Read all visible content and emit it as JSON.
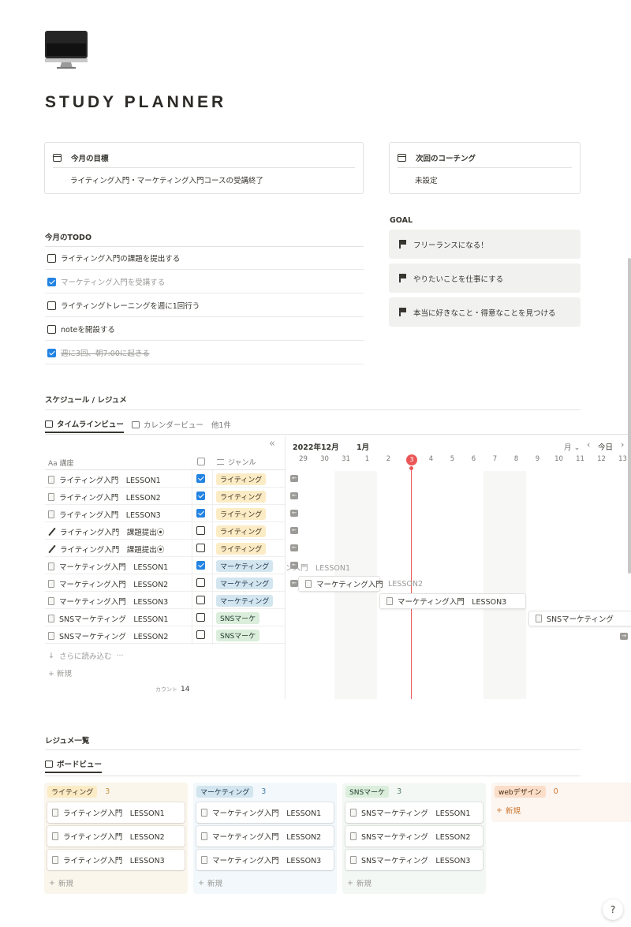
{
  "page": {
    "title": "STUDY PLANNER",
    "icon": "desktop-computer-icon"
  },
  "callouts": {
    "monthly_goal": {
      "title": "今月の目標",
      "text": "ライティング入門・マーケティング入門コースの受講終了"
    },
    "next_coaching": {
      "title": "次回のコーチング",
      "text": "未設定"
    }
  },
  "todo": {
    "heading": "今月のTODO",
    "items": [
      {
        "label": "ライティング入門の課題を提出する",
        "checked": false
      },
      {
        "label": "マーケティング入門を受講する",
        "checked": true
      },
      {
        "label": "ライティングトレーニングを週に1回行う",
        "checked": false
      },
      {
        "label": "noteを開設する",
        "checked": false
      },
      {
        "label": "週に3回、朝7:00に起きる",
        "checked": true
      }
    ]
  },
  "goal": {
    "heading": "GOAL",
    "items": [
      "フリーランスになる！",
      "やりたいことを仕事にする",
      "本当に好きなこと・得意なことを見つける"
    ]
  },
  "schedule": {
    "heading": "スケジュール / レジュメ",
    "tabs": [
      "タイムラインビュー",
      "カレンダービュー",
      "他1件"
    ],
    "collapse": "«",
    "col_course": "Aa 講座",
    "col_genre": "ジャンル",
    "rows": [
      {
        "name": "ライティング入門　LESSON1",
        "checked": true,
        "genre": "ライティング",
        "icon": "doc"
      },
      {
        "name": "ライティング入門　LESSON2",
        "checked": true,
        "genre": "ライティング",
        "icon": "doc"
      },
      {
        "name": "ライティング入門　LESSON3",
        "checked": true,
        "genre": "ライティング",
        "icon": "doc"
      },
      {
        "name": "ライティング入門　課題提出⦿",
        "checked": false,
        "genre": "ライティング",
        "icon": "pencil"
      },
      {
        "name": "ライティング入門　課題提出⦿",
        "checked": false,
        "genre": "ライティング",
        "icon": "pencil"
      },
      {
        "name": "マーケティング入門　LESSON1",
        "checked": true,
        "genre": "マーケティング",
        "icon": "doc"
      },
      {
        "name": "マーケティング入門　LESSON2",
        "checked": false,
        "genre": "マーケティング",
        "icon": "doc"
      },
      {
        "name": "マーケティング入門　LESSON3",
        "checked": false,
        "genre": "マーケティング",
        "icon": "doc"
      },
      {
        "name": "SNSマーケティング　LESSON1",
        "checked": false,
        "genre": "SNSマーケ",
        "icon": "doc"
      },
      {
        "name": "SNSマーケティング　LESSON2",
        "checked": false,
        "genre": "SNSマーケ",
        "icon": "doc"
      }
    ],
    "load_more": "さらに読み込む",
    "new": "新規",
    "count_label": "カウント",
    "count": "14",
    "months": [
      "2022年12月",
      "1月"
    ],
    "scale": "月",
    "today": "今日",
    "days": [
      "29",
      "30",
      "31",
      "1",
      "2",
      "3",
      "4",
      "5",
      "6",
      "7",
      "8",
      "9",
      "10",
      "11",
      "12",
      "13"
    ],
    "today_day": "3",
    "bars": {
      "m1_ghost": "ン入門　LESSON1",
      "m2": "マーケティング入門",
      "m2_ghost": "LESSON2",
      "m3": "マーケティング入門　LESSON3",
      "s1": "SNSマーケティング"
    }
  },
  "resume": {
    "heading": "レジュメ一覧",
    "tab": "ボードビュー",
    "columns": [
      {
        "name": "ライティング",
        "count": "3",
        "cards": [
          "ライティング入門　LESSON1",
          "ライティング入門　LESSON2",
          "ライティング入門　LESSON3"
        ],
        "bg": "#fbf6ec",
        "cnt_color": "#c29343"
      },
      {
        "name": "マーケティング",
        "count": "3",
        "cards": [
          "マーケティング入門　LESSON1",
          "マーケティング入門　LESSON2",
          "マーケティング入門　LESSON3"
        ],
        "bg": "#f2f8fb",
        "cnt_color": "#487ca5"
      },
      {
        "name": "SNSマーケ",
        "count": "3",
        "cards": [
          "SNSマーケティング　LESSON1",
          "SNSマーケティング　LESSON2",
          "SNSマーケティング　LESSON3"
        ],
        "bg": "#f4f8f4",
        "cnt_color": "#548164"
      },
      {
        "name": "webデザイン",
        "count": "0",
        "cards": [],
        "bg": "#fcf5f0",
        "cnt_color": "#cc782f"
      }
    ],
    "new": "新規"
  },
  "help": "?"
}
